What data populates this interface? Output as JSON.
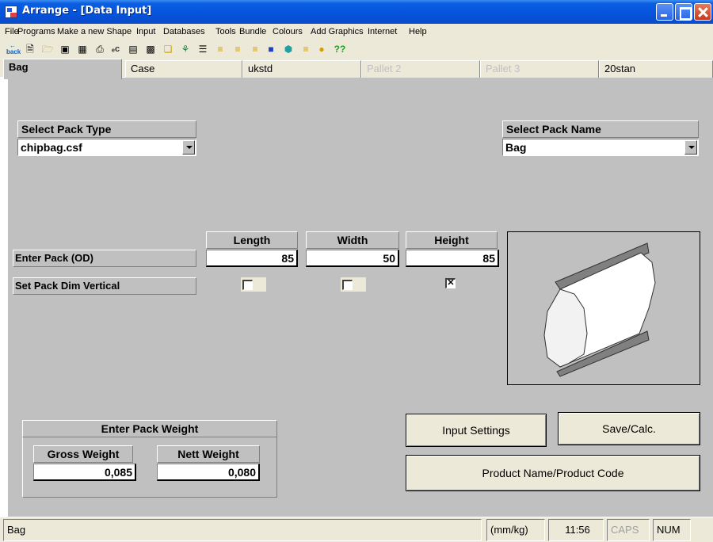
{
  "window": {
    "title": "Arrange - [Data Input]"
  },
  "menu": [
    "File",
    "Programs",
    "Make a new Shape",
    "Input",
    "Databases",
    "Tools",
    "Bundle",
    "Colours",
    "Add Graphics",
    "Internet",
    "Help"
  ],
  "toolbar": {
    "back_label": "back"
  },
  "tabs": [
    {
      "label": "Bag",
      "state": "active"
    },
    {
      "label": "Case",
      "state": "normal"
    },
    {
      "label": "ukstd",
      "state": "normal"
    },
    {
      "label": "Pallet 2",
      "state": "disabled"
    },
    {
      "label": "Pallet 3",
      "state": "disabled"
    },
    {
      "label": "20stan",
      "state": "normal"
    }
  ],
  "pack_type": {
    "label": "Select Pack Type",
    "value": "chipbag.csf"
  },
  "pack_name": {
    "label": "Select Pack Name",
    "value": "Bag"
  },
  "dimensions": {
    "headers": {
      "length": "Length",
      "width": "Width",
      "height": "Height"
    },
    "row_od_label": "Enter Pack (OD)",
    "length": "85",
    "width": "50",
    "height": "85",
    "row_vertical_label": "Set Pack Dim Vertical",
    "vertical": {
      "length": false,
      "width": false,
      "height": true
    }
  },
  "weight": {
    "title": "Enter Pack Weight",
    "gross_label": "Gross Weight",
    "gross_value": "0,085",
    "nett_label": "Nett Weight",
    "nett_value": "0,080"
  },
  "buttons": {
    "input_settings": "Input Settings",
    "save_calc": "Save/Calc.",
    "product_name": "Product Name/Product Code"
  },
  "status": {
    "left": "Bag",
    "units": "(mm/kg)",
    "time": "11:56",
    "caps": "CAPS",
    "num": "NUM"
  },
  "colors": {
    "title_bar": "#0553dc",
    "panel_bg": "#c0c0c0",
    "chrome_bg": "#ece9d8"
  }
}
